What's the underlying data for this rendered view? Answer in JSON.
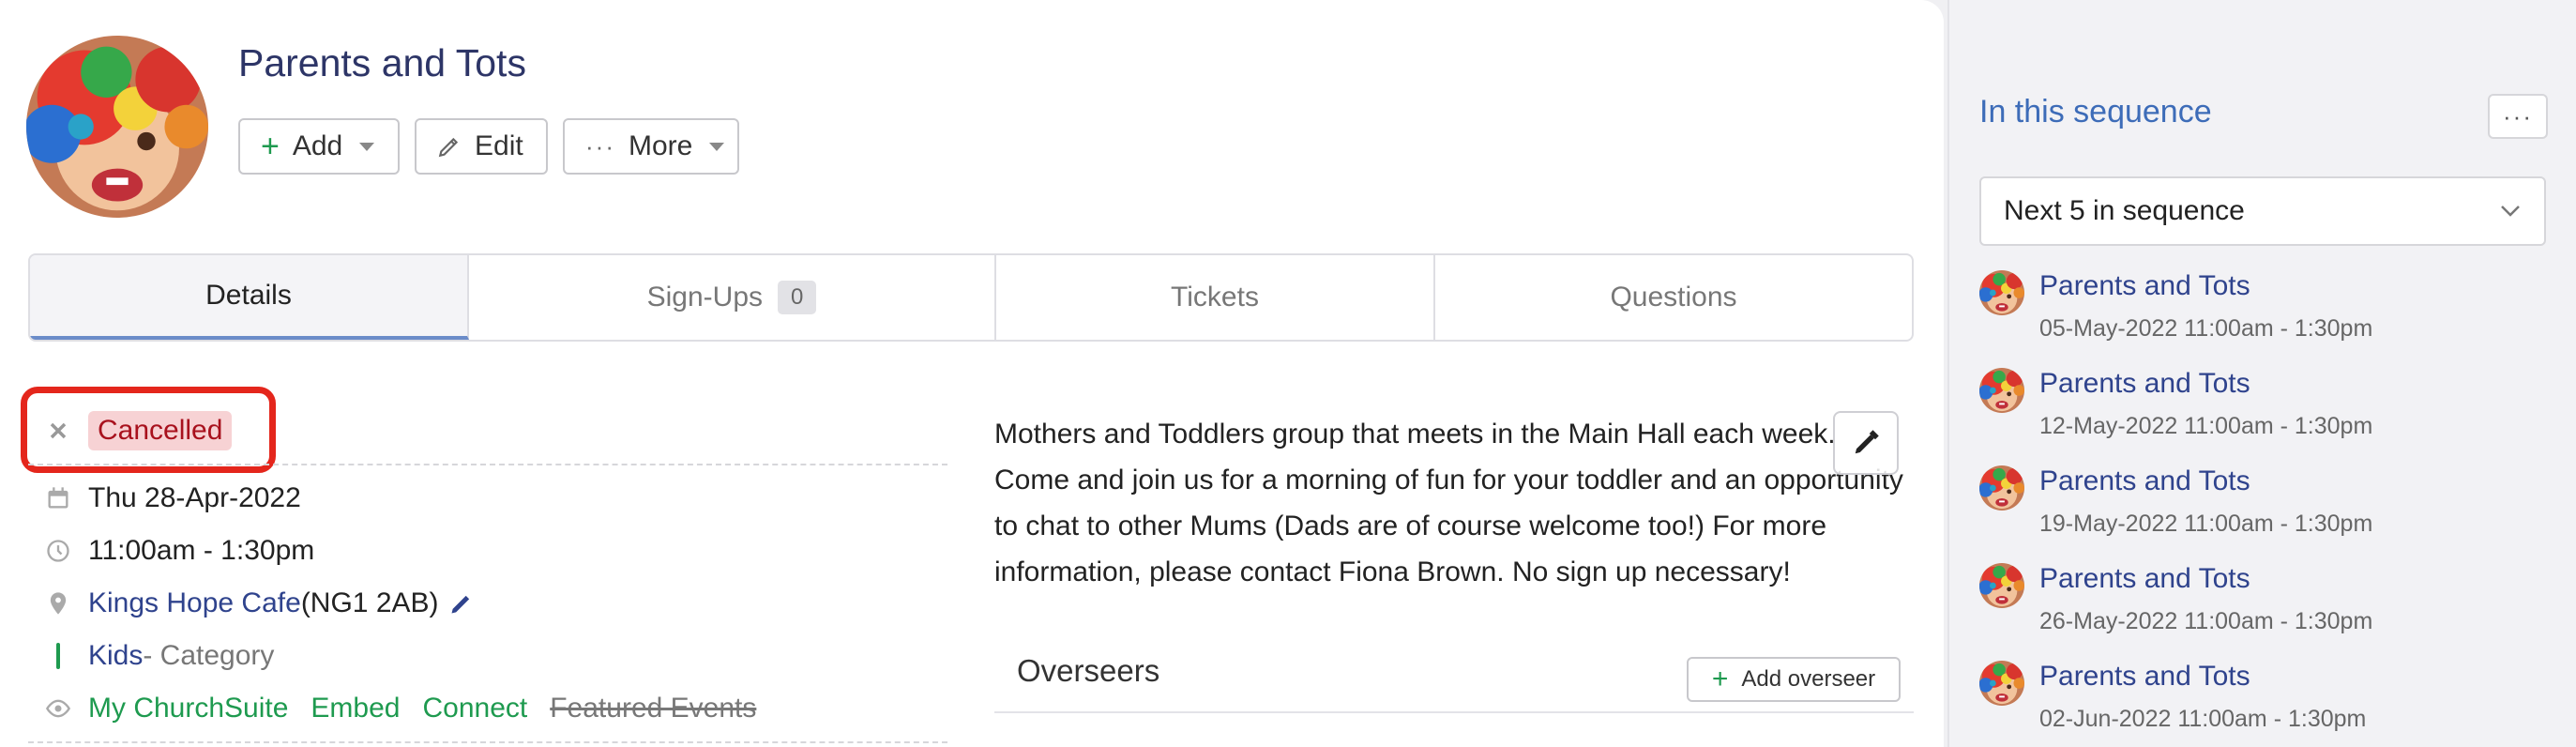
{
  "colors": {
    "title": "#2d3567",
    "link": "#2f438d",
    "green": "#1e9a4f",
    "cancelled_bg": "#f7d2d4",
    "cancelled_text": "#a8111d",
    "highlight": "#e4261c",
    "tab_active_underline": "#6b8cc9",
    "sequence_title": "#3d6cb8"
  },
  "event": {
    "title": "Parents and Tots",
    "avatar_icon": "child-painted-hands-avatar"
  },
  "toolbar": {
    "add_label": "Add",
    "edit_label": "Edit",
    "more_label": "More"
  },
  "tabs": [
    {
      "label": "Details",
      "active": true
    },
    {
      "label": "Sign-Ups",
      "count": "0"
    },
    {
      "label": "Tickets"
    },
    {
      "label": "Questions"
    }
  ],
  "details": {
    "status": "Cancelled",
    "date": "Thu 28-Apr-2022",
    "time": "11:00am - 1:30pm",
    "location_name": "Kings Hope Cafe",
    "location_postcode": " (NG1 2AB)",
    "category_name": "Kids",
    "category_suffix": " - Category",
    "visibility": [
      "My ChurchSuite",
      "Embed",
      "Connect"
    ],
    "visibility_off": "Featured Events"
  },
  "description": "Mothers and Toddlers group that meets in the Main Hall each week. Come and join us for a morning of fun for your toddler and an opportunity to chat to other Mums (Dads are of course welcome too!) For more information, please contact Fiona Brown. No sign up necessary!",
  "overseers": {
    "title": "Overseers",
    "add_label": "Add overseer"
  },
  "sequence": {
    "title": "In this sequence",
    "more_label": "···",
    "select_value": "Next 5 in sequence",
    "items": [
      {
        "name": "Parents and Tots",
        "date": "05-May-2022 11:00am - 1:30pm"
      },
      {
        "name": "Parents and Tots",
        "date": "12-May-2022 11:00am - 1:30pm"
      },
      {
        "name": "Parents and Tots",
        "date": "19-May-2022 11:00am - 1:30pm"
      },
      {
        "name": "Parents and Tots",
        "date": "26-May-2022 11:00am - 1:30pm"
      },
      {
        "name": "Parents and Tots",
        "date": "02-Jun-2022 11:00am - 1:30pm"
      }
    ]
  }
}
